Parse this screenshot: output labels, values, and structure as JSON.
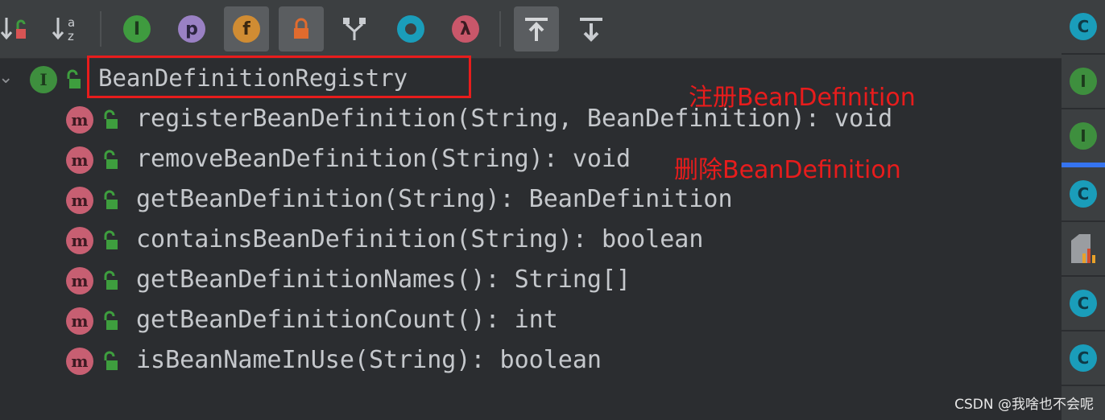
{
  "toolbar": {
    "sort_alpha_icon_letters": "a z",
    "interface_letter": "I",
    "property_letter": "p",
    "field_letter": "f",
    "lambda_letter": "λ"
  },
  "tree": {
    "root": {
      "kind": "I",
      "label": "BeanDefinitionRegistry"
    },
    "methods": [
      {
        "kind": "m",
        "label": "registerBeanDefinition(String, BeanDefinition): void"
      },
      {
        "kind": "m",
        "label": "removeBeanDefinition(String): void"
      },
      {
        "kind": "m",
        "label": "getBeanDefinition(String): BeanDefinition"
      },
      {
        "kind": "m",
        "label": "containsBeanDefinition(String): boolean"
      },
      {
        "kind": "m",
        "label": "getBeanDefinitionNames(): String[]"
      },
      {
        "kind": "m",
        "label": "getBeanDefinitionCount(): int"
      },
      {
        "kind": "m",
        "label": "isBeanNameInUse(String): boolean"
      }
    ]
  },
  "annotations": {
    "register": "注册BeanDefinition",
    "remove": "删除BeanDefinition"
  },
  "right_strip": {
    "items": [
      "C",
      "I",
      "I",
      "C",
      "chart",
      "C",
      "C"
    ]
  },
  "watermark": "CSDN @我啥也不会呢",
  "colors": {
    "annotation_red": "#e81c1c",
    "selection_blue": "#3574f0",
    "interface_green": "#3e8f3e",
    "method_pink": "#c75f72",
    "class_teal": "#1a9dba"
  }
}
